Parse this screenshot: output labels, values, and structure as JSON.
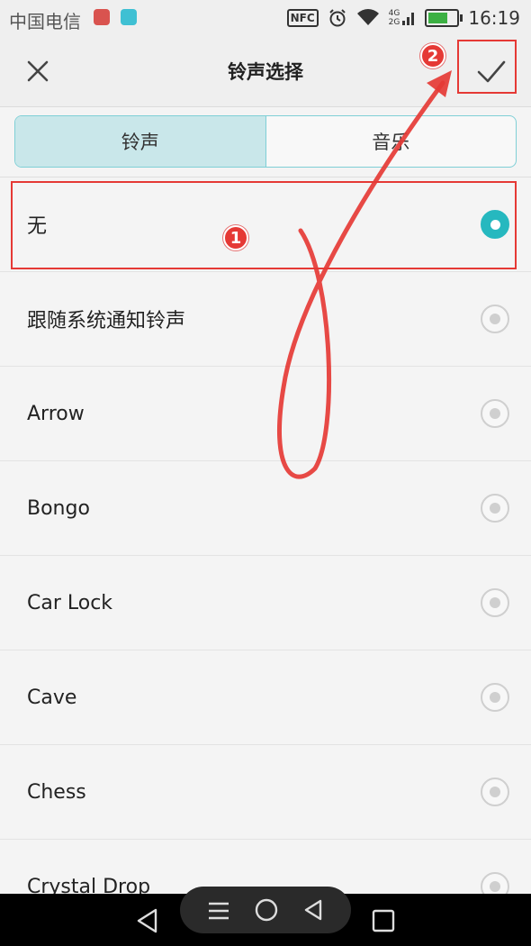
{
  "status_bar": {
    "carrier": "中国电信",
    "nfc": "NFC",
    "network_top": "4G",
    "network_bottom": "2G",
    "battery_level": 0.75,
    "time": "16:19"
  },
  "header": {
    "title": "铃声选择",
    "close_icon": "close-icon",
    "confirm_icon": "checkmark-icon"
  },
  "tabs": [
    {
      "label": "铃声",
      "active": true
    },
    {
      "label": "音乐",
      "active": false
    }
  ],
  "ringtones": [
    {
      "label": "无",
      "selected": true
    },
    {
      "label": "跟随系统通知铃声",
      "selected": false
    },
    {
      "label": "Arrow",
      "selected": false
    },
    {
      "label": "Bongo",
      "selected": false
    },
    {
      "label": "Car Lock",
      "selected": false
    },
    {
      "label": "Cave",
      "selected": false
    },
    {
      "label": "Chess",
      "selected": false
    },
    {
      "label": "Crystal Drop",
      "selected": false
    }
  ],
  "annotations": {
    "step1": "1",
    "step2": "2",
    "color": "#e53935"
  },
  "colors": {
    "accent": "#26b8bf",
    "tab_active_bg": "#c9e7ea",
    "annotation_red": "#e53935"
  }
}
